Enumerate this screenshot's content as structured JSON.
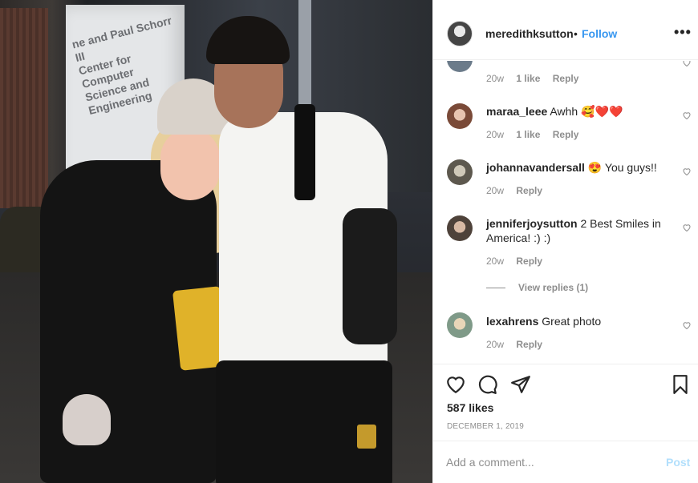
{
  "photo": {
    "sign_lines": [
      "ne and Paul Schorr III",
      "Center for Computer",
      "Science and Engineering"
    ]
  },
  "header": {
    "username": "meredithksutton",
    "separator": "•",
    "follow_label": "Follow",
    "more_label": "•••"
  },
  "comments": [
    {
      "username": "",
      "text": "",
      "time": "20w",
      "likes": "1 like",
      "reply": "Reply",
      "avatar_color": "#6b7b8a"
    },
    {
      "username": "maraa_leee",
      "text": "Awhh 🥰❤️❤️",
      "time": "20w",
      "likes": "1 like",
      "reply": "Reply",
      "avatar_color": "#8a5a48"
    },
    {
      "username": "johannavandersall",
      "text": "😍 You guys!!",
      "time": "20w",
      "likes": "",
      "reply": "Reply",
      "avatar_color": "#7a7466"
    },
    {
      "username": "jenniferjoysutton",
      "text": "2 Best Smiles in America! :) :)",
      "time": "20w",
      "likes": "",
      "reply": "Reply",
      "avatar_color": "#6d5d52"
    },
    {
      "username": "lexahrens",
      "text": "Great photo",
      "time": "20w",
      "likes": "",
      "reply": "Reply",
      "avatar_color": "#a89a7a"
    }
  ],
  "view_replies": "View replies (1)",
  "actions": {
    "like_count": "587 likes",
    "date": "DECEMBER 1, 2019"
  },
  "add_comment": {
    "placeholder": "Add a comment...",
    "post_label": "Post"
  },
  "colors": {
    "link_blue": "#3897f0",
    "post_disabled": "#b2dffc",
    "secondary_text": "#8e8e8e"
  }
}
